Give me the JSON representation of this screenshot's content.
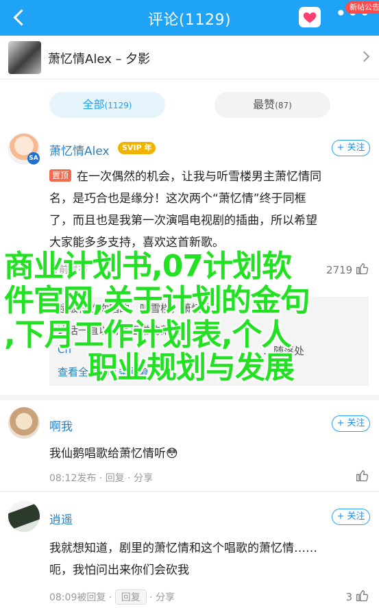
{
  "topbar": {
    "title": "评论(1129)",
    "more": "•••",
    "notice_badge": "新帖公告",
    "colors": {
      "bar": "#1fa3f6",
      "heart": "#ff3d6e"
    }
  },
  "post": {
    "title": "萧忆情Alex – 夕影"
  },
  "tabs": [
    {
      "label": "全部",
      "count": "(1129)",
      "active": true
    },
    {
      "label": "最赞",
      "count": "(87)",
      "active": false
    }
  ],
  "follow_label": "+ 关注",
  "comments": [
    {
      "user": "萧忆情Alex",
      "vip": "SVIP",
      "vip_level": "年",
      "pin": "置顶",
      "lines": [
        "在一次偶然的机会，让我与听雪楼男主萧忆情同",
        "名，是巧合也是缘分！这次两个“萧忆情”终于同框",
        "了，而且也是我第一次演唱电视剧的插曲，所以希望",
        "大家能多多支持，喜欢这首新歌。"
      ],
      "meta_visible": "钟前发布",
      "likes": "2719",
      "replies": [
        {
          "name": "",
          "text": "超级喜欢你唱的，听雪楼，萧忆情"
        },
        {
          "name": "",
          "text": "这话一直以为是正常的萧忆情"
        },
        {
          "name": "Ch",
          "text": "…随落处"
        }
      ],
      "reply_more": "查看全部171条回复"
    },
    {
      "user": "啊我",
      "text": "我仙鹅唱歌给萧忆情听",
      "emoji": "😳",
      "time": "08:12发布",
      "reply": "回复",
      "share": "分享"
    },
    {
      "user": "逍遥",
      "lines": [
        "我就想知道，剧里的萧忆情和这个唱歌的萧忆情……",
        "呃，我怕问出来你们会砍我"
      ],
      "time": "08:09被回复",
      "reply": "回复",
      "share": "分享",
      "likes": "3"
    }
  ],
  "overlay": {
    "lines": [
      "商业计划书,07计划软",
      "件官网,关于计划的金句",
      ",下月工作计划表,个人",
      "职业规划与发展"
    ],
    "color": "#22e022"
  }
}
